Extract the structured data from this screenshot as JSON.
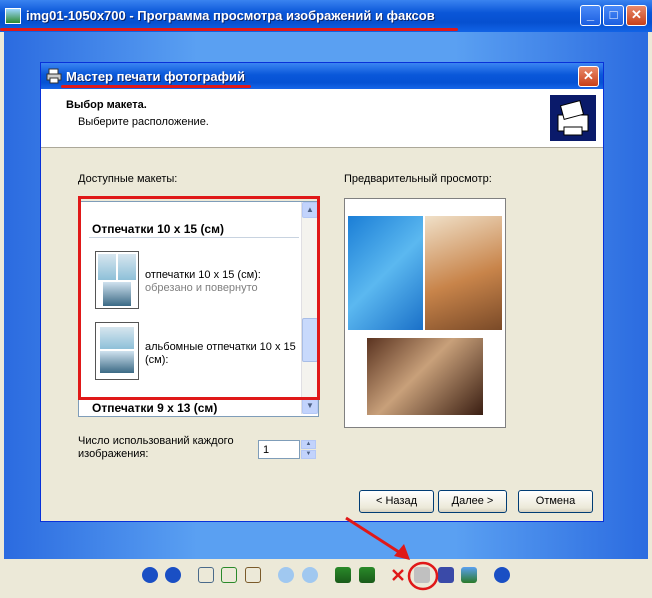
{
  "window": {
    "title": "img01-1050x700 - Программа просмотра изображений и факсов",
    "minimize": "_",
    "maximize": "□",
    "close": "✕"
  },
  "dialog": {
    "title": "Мастер печати фотографий",
    "close": "✕",
    "header_title": "Выбор макета.",
    "header_subtitle": "Выберите расположение.",
    "layouts_label": "Доступные макеты:",
    "preview_label": "Предварительный просмотр:",
    "layouts": {
      "group1": "Отпечатки 10 x 15 (см)",
      "item1_line1": "отпечатки 10 x 15 (см):",
      "item1_line2": "обрезано и повернуто",
      "item2_line1": "альбомные отпечатки 10 x 15",
      "item2_line2": "(см):",
      "group2": "Отпечатки 9 x 13 (см)"
    },
    "copies_label_line1": "Число использований каждого",
    "copies_label_line2": "изображения:",
    "copies_value": "1",
    "back_button": "< Назад",
    "next_button": "Далее >",
    "cancel_button": "Отмена"
  },
  "toolbar": {
    "icons": [
      "previous-icon",
      "next-icon",
      "best-fit-icon",
      "actual-size-icon",
      "slideshow-icon",
      "zoom-in-icon",
      "zoom-out-icon",
      "rotate-clockwise-icon",
      "rotate-counterclockwise-icon",
      "delete-icon",
      "print-icon",
      "save-icon",
      "edit-icon",
      "help-icon"
    ]
  },
  "colors": {
    "annotation_red": "#e01818",
    "titlebar_blue": "#0a58da",
    "desktop_blue": "#5aa0f2"
  }
}
